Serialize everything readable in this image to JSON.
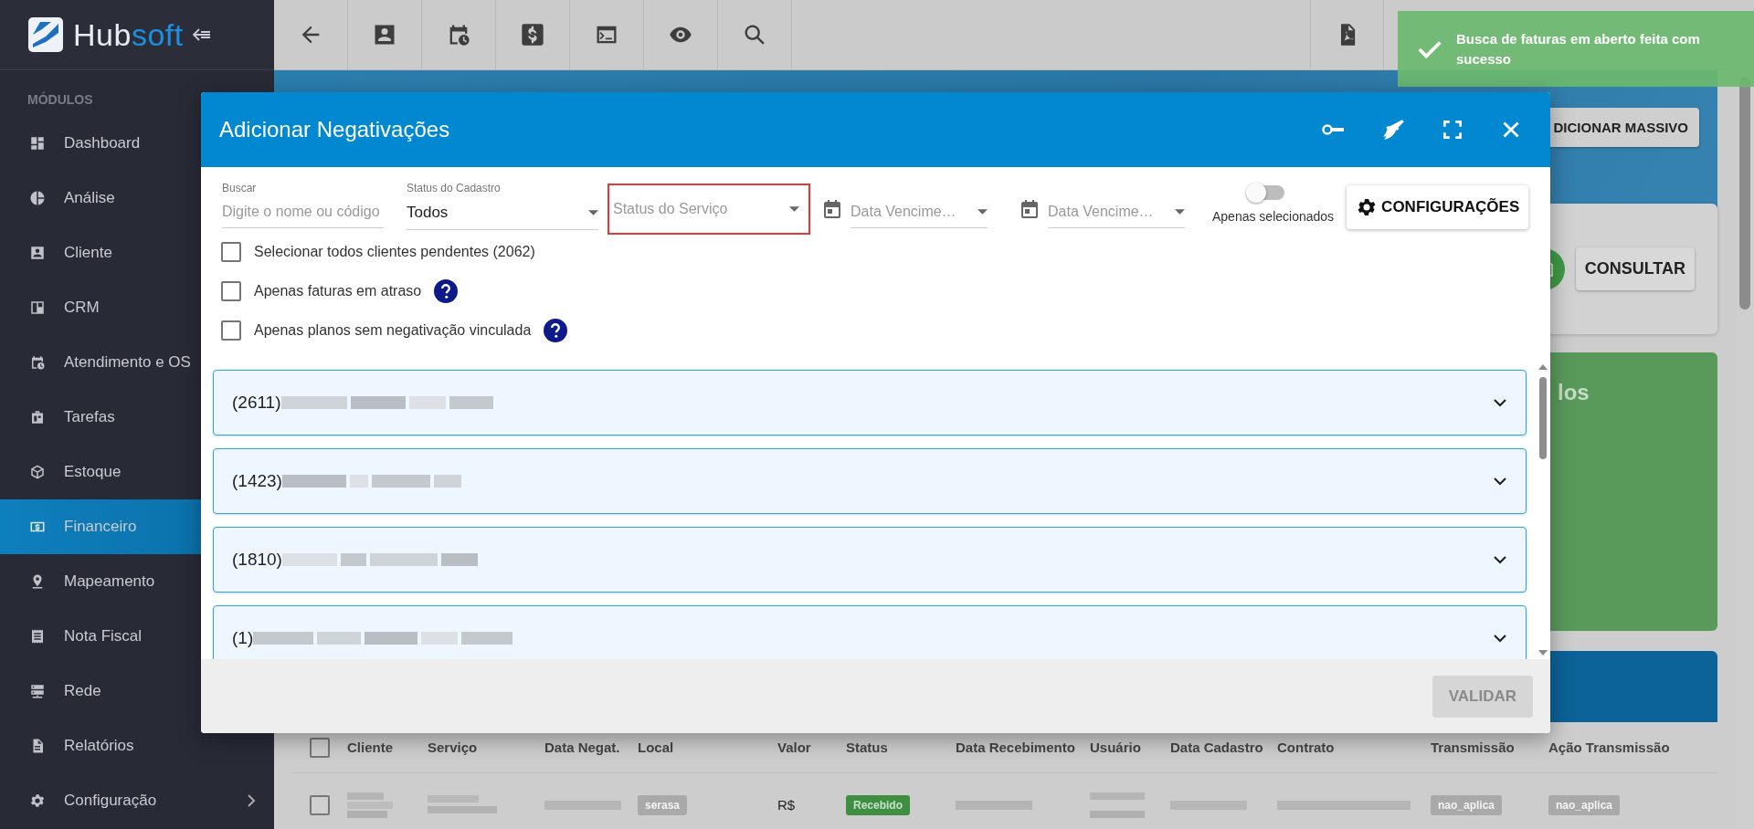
{
  "logo": {
    "part1": "Hub",
    "part2": "soft"
  },
  "sidebar": {
    "heading": "MÓDULOS",
    "items": [
      {
        "label": "Dashboard",
        "selected": false,
        "has_submenu": false
      },
      {
        "label": "Análise",
        "selected": false,
        "has_submenu": false
      },
      {
        "label": "Cliente",
        "selected": false,
        "has_submenu": false
      },
      {
        "label": "CRM",
        "selected": false,
        "has_submenu": false
      },
      {
        "label": "Atendimento e OS",
        "selected": false,
        "has_submenu": false
      },
      {
        "label": "Tarefas",
        "selected": false,
        "has_submenu": false
      },
      {
        "label": "Estoque",
        "selected": false,
        "has_submenu": false
      },
      {
        "label": "Financeiro",
        "selected": true,
        "has_submenu": false
      },
      {
        "label": "Mapeamento",
        "selected": false,
        "has_submenu": false
      },
      {
        "label": "Nota Fiscal",
        "selected": false,
        "has_submenu": false
      },
      {
        "label": "Rede",
        "selected": false,
        "has_submenu": false
      },
      {
        "label": "Relatórios",
        "selected": false,
        "has_submenu": false
      },
      {
        "label": "Configuração",
        "selected": false,
        "has_submenu": true
      }
    ]
  },
  "toast": {
    "message": "Busca de faturas em aberto feita com sucesso"
  },
  "background": {
    "massive_button": "DICIONAR MASSIVO",
    "consult_button": "CONSULTAR",
    "green_card_text": "los",
    "table": {
      "columns": [
        "Cliente",
        "Serviço",
        "Data Negat.",
        "Local",
        "Valor",
        "Status",
        "Data Recebimento",
        "Usuário",
        "Data Cadastro",
        "Contrato",
        "Transmissão",
        "Ação Transmissão"
      ],
      "select_all_checked": false,
      "row": {
        "checked": false,
        "local": "serasa",
        "value": "R$",
        "status": "Recebido",
        "transmission": "nao_aplica",
        "transmission_action": "nao_aplica"
      }
    }
  },
  "modal": {
    "title": "Adicionar Negativações",
    "filters": [
      {
        "kind": "text",
        "label": "Buscar",
        "placeholder": "Digite o nome ou código",
        "highlighted": false
      },
      {
        "kind": "select",
        "label": "Status do Cadastro",
        "value": "Todos",
        "highlighted": false
      },
      {
        "kind": "select",
        "placeholder": "Status do Serviço",
        "highlighted": true
      },
      {
        "kind": "date",
        "placeholder": "Data Vencime…",
        "highlighted": false
      },
      {
        "kind": "date",
        "placeholder": "Data Vencime…",
        "highlighted": false
      }
    ],
    "toggle": {
      "label": "Apenas selecionados",
      "on": false
    },
    "config_button": "CONFIGURAÇÕES",
    "options": [
      {
        "label": "Selecionar todos clientes pendentes (2062)",
        "checked": false
      },
      {
        "label": "Apenas faturas em atraso",
        "checked": false,
        "help": true
      },
      {
        "label": "Apenas planos sem negativação vinculada",
        "checked": false,
        "help": true
      }
    ],
    "clients": [
      {
        "code": "(2611)",
        "expanded": false
      },
      {
        "code": "(1423)",
        "expanded": false
      },
      {
        "code": "(1810)",
        "expanded": false
      },
      {
        "code": "(1)",
        "expanded": false
      }
    ],
    "validate_button": {
      "label": "VALIDAR",
      "disabled": true
    }
  }
}
